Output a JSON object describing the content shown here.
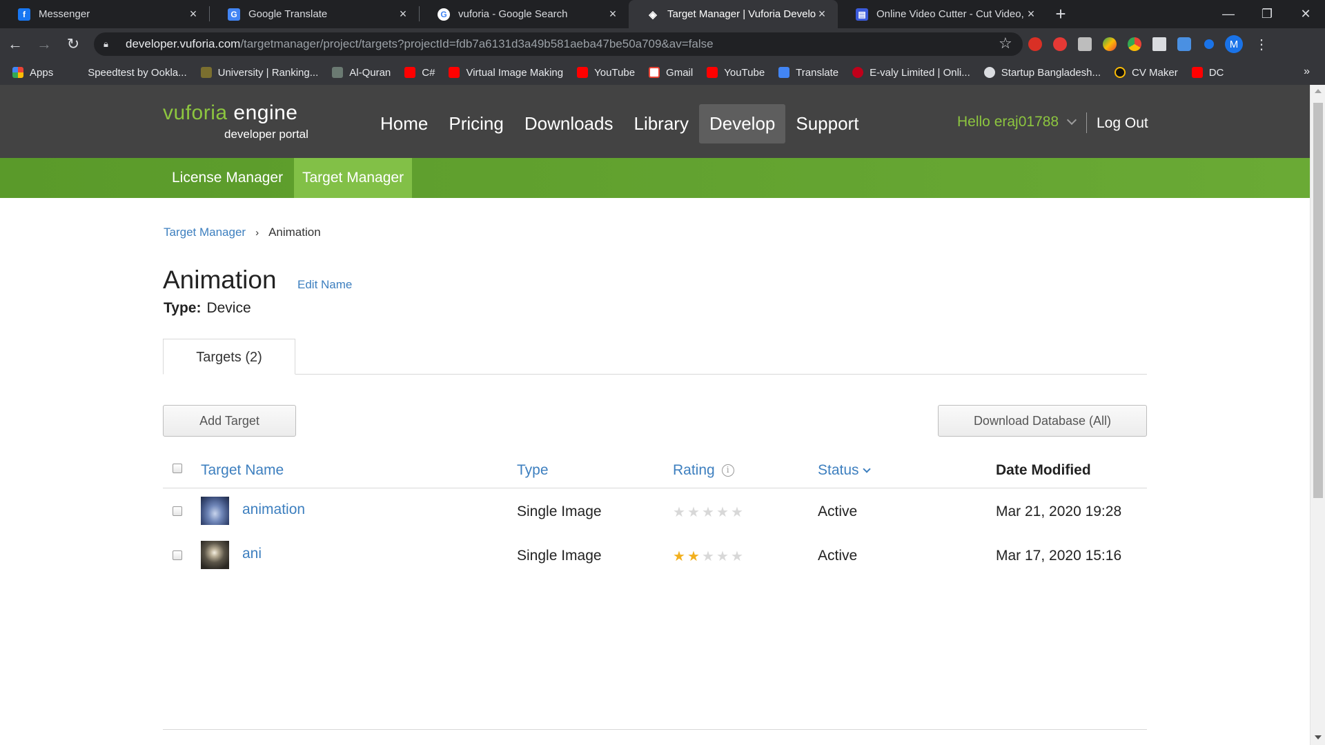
{
  "browser": {
    "tabs": [
      {
        "title": "Messenger",
        "icon": "facebook-icon",
        "color": "#1877f2",
        "glyph": "f"
      },
      {
        "title": "Google Translate",
        "icon": "translate-icon",
        "color": "#4285f4",
        "glyph": "G"
      },
      {
        "title": "vuforia - Google Search",
        "icon": "google-icon",
        "color": "#ffffff",
        "glyph": "G"
      },
      {
        "title": "Target Manager | Vuforia Develop",
        "icon": "vuforia-icon",
        "color": "#ffffff",
        "glyph": "◈"
      },
      {
        "title": "Online Video Cutter - Cut Video,",
        "icon": "video-cutter-icon",
        "color": "#3b5bdb",
        "glyph": "▤"
      }
    ],
    "active_tab": 3,
    "url_host": "developer.vuforia.com",
    "url_path": "/targetmanager/project/targets?projectId=fdb7a6131d3a49b581aeba47be50a709&av=false",
    "profile_initial": "M",
    "bookmarks": [
      {
        "label": "Apps",
        "color": "#ea4335"
      },
      {
        "label": "Speedtest by Ookla...",
        "color": "#35363a"
      },
      {
        "label": "University | Ranking...",
        "color": "#7b6f2f"
      },
      {
        "label": "Al-Quran",
        "color": "#6b7a72"
      },
      {
        "label": "C#",
        "color": "#ff0000"
      },
      {
        "label": "Virtual Image Making",
        "color": "#ff0000"
      },
      {
        "label": "YouTube",
        "color": "#ff0000"
      },
      {
        "label": "Gmail",
        "color": "#ea4335"
      },
      {
        "label": "YouTube",
        "color": "#ff0000"
      },
      {
        "label": "Translate",
        "color": "#4285f4"
      },
      {
        "label": "E-valy Limited | Onli...",
        "color": "#c0001a"
      },
      {
        "label": "Startup Bangladesh...",
        "color": "#dadce0"
      },
      {
        "label": "CV Maker",
        "color": "#111111"
      },
      {
        "label": "DC",
        "color": "#ff0000"
      }
    ],
    "bookmarks_more": "»"
  },
  "site": {
    "logo": {
      "brand_1": "vuforia",
      "brand_2": "engine",
      "sub": "developer portal"
    },
    "nav": [
      "Home",
      "Pricing",
      "Downloads",
      "Library",
      "Develop",
      "Support"
    ],
    "active_nav": "Develop",
    "user_greeting": "Hello eraj01788",
    "logout": "Log Out",
    "subnav": [
      "License Manager",
      "Target Manager"
    ],
    "active_subnav": "Target Manager"
  },
  "breadcrumb": {
    "link": "Target Manager",
    "separator": "›",
    "current": "Animation"
  },
  "project": {
    "title": "Animation",
    "edit_name": "Edit Name",
    "type_label": "Type:",
    "type_value": "Device",
    "tab": "Targets (2)"
  },
  "buttons": {
    "add_target": "Add Target",
    "download_db": "Download Database (All)"
  },
  "table": {
    "headers": {
      "name": "Target Name",
      "type": "Type",
      "rating": "Rating",
      "status": "Status",
      "date": "Date Modified"
    },
    "rows": [
      {
        "name": "animation",
        "type": "Single Image",
        "rating": 0,
        "status": "Active",
        "date": "Mar 21, 2020 19:28"
      },
      {
        "name": "ani",
        "type": "Single Image",
        "rating": 2,
        "status": "Active",
        "date": "Mar 17, 2020 15:16"
      }
    ]
  },
  "colors": {
    "accent_green": "#8dc63f",
    "link_blue": "#3d7fbf",
    "star_on": "#f2b01e"
  }
}
